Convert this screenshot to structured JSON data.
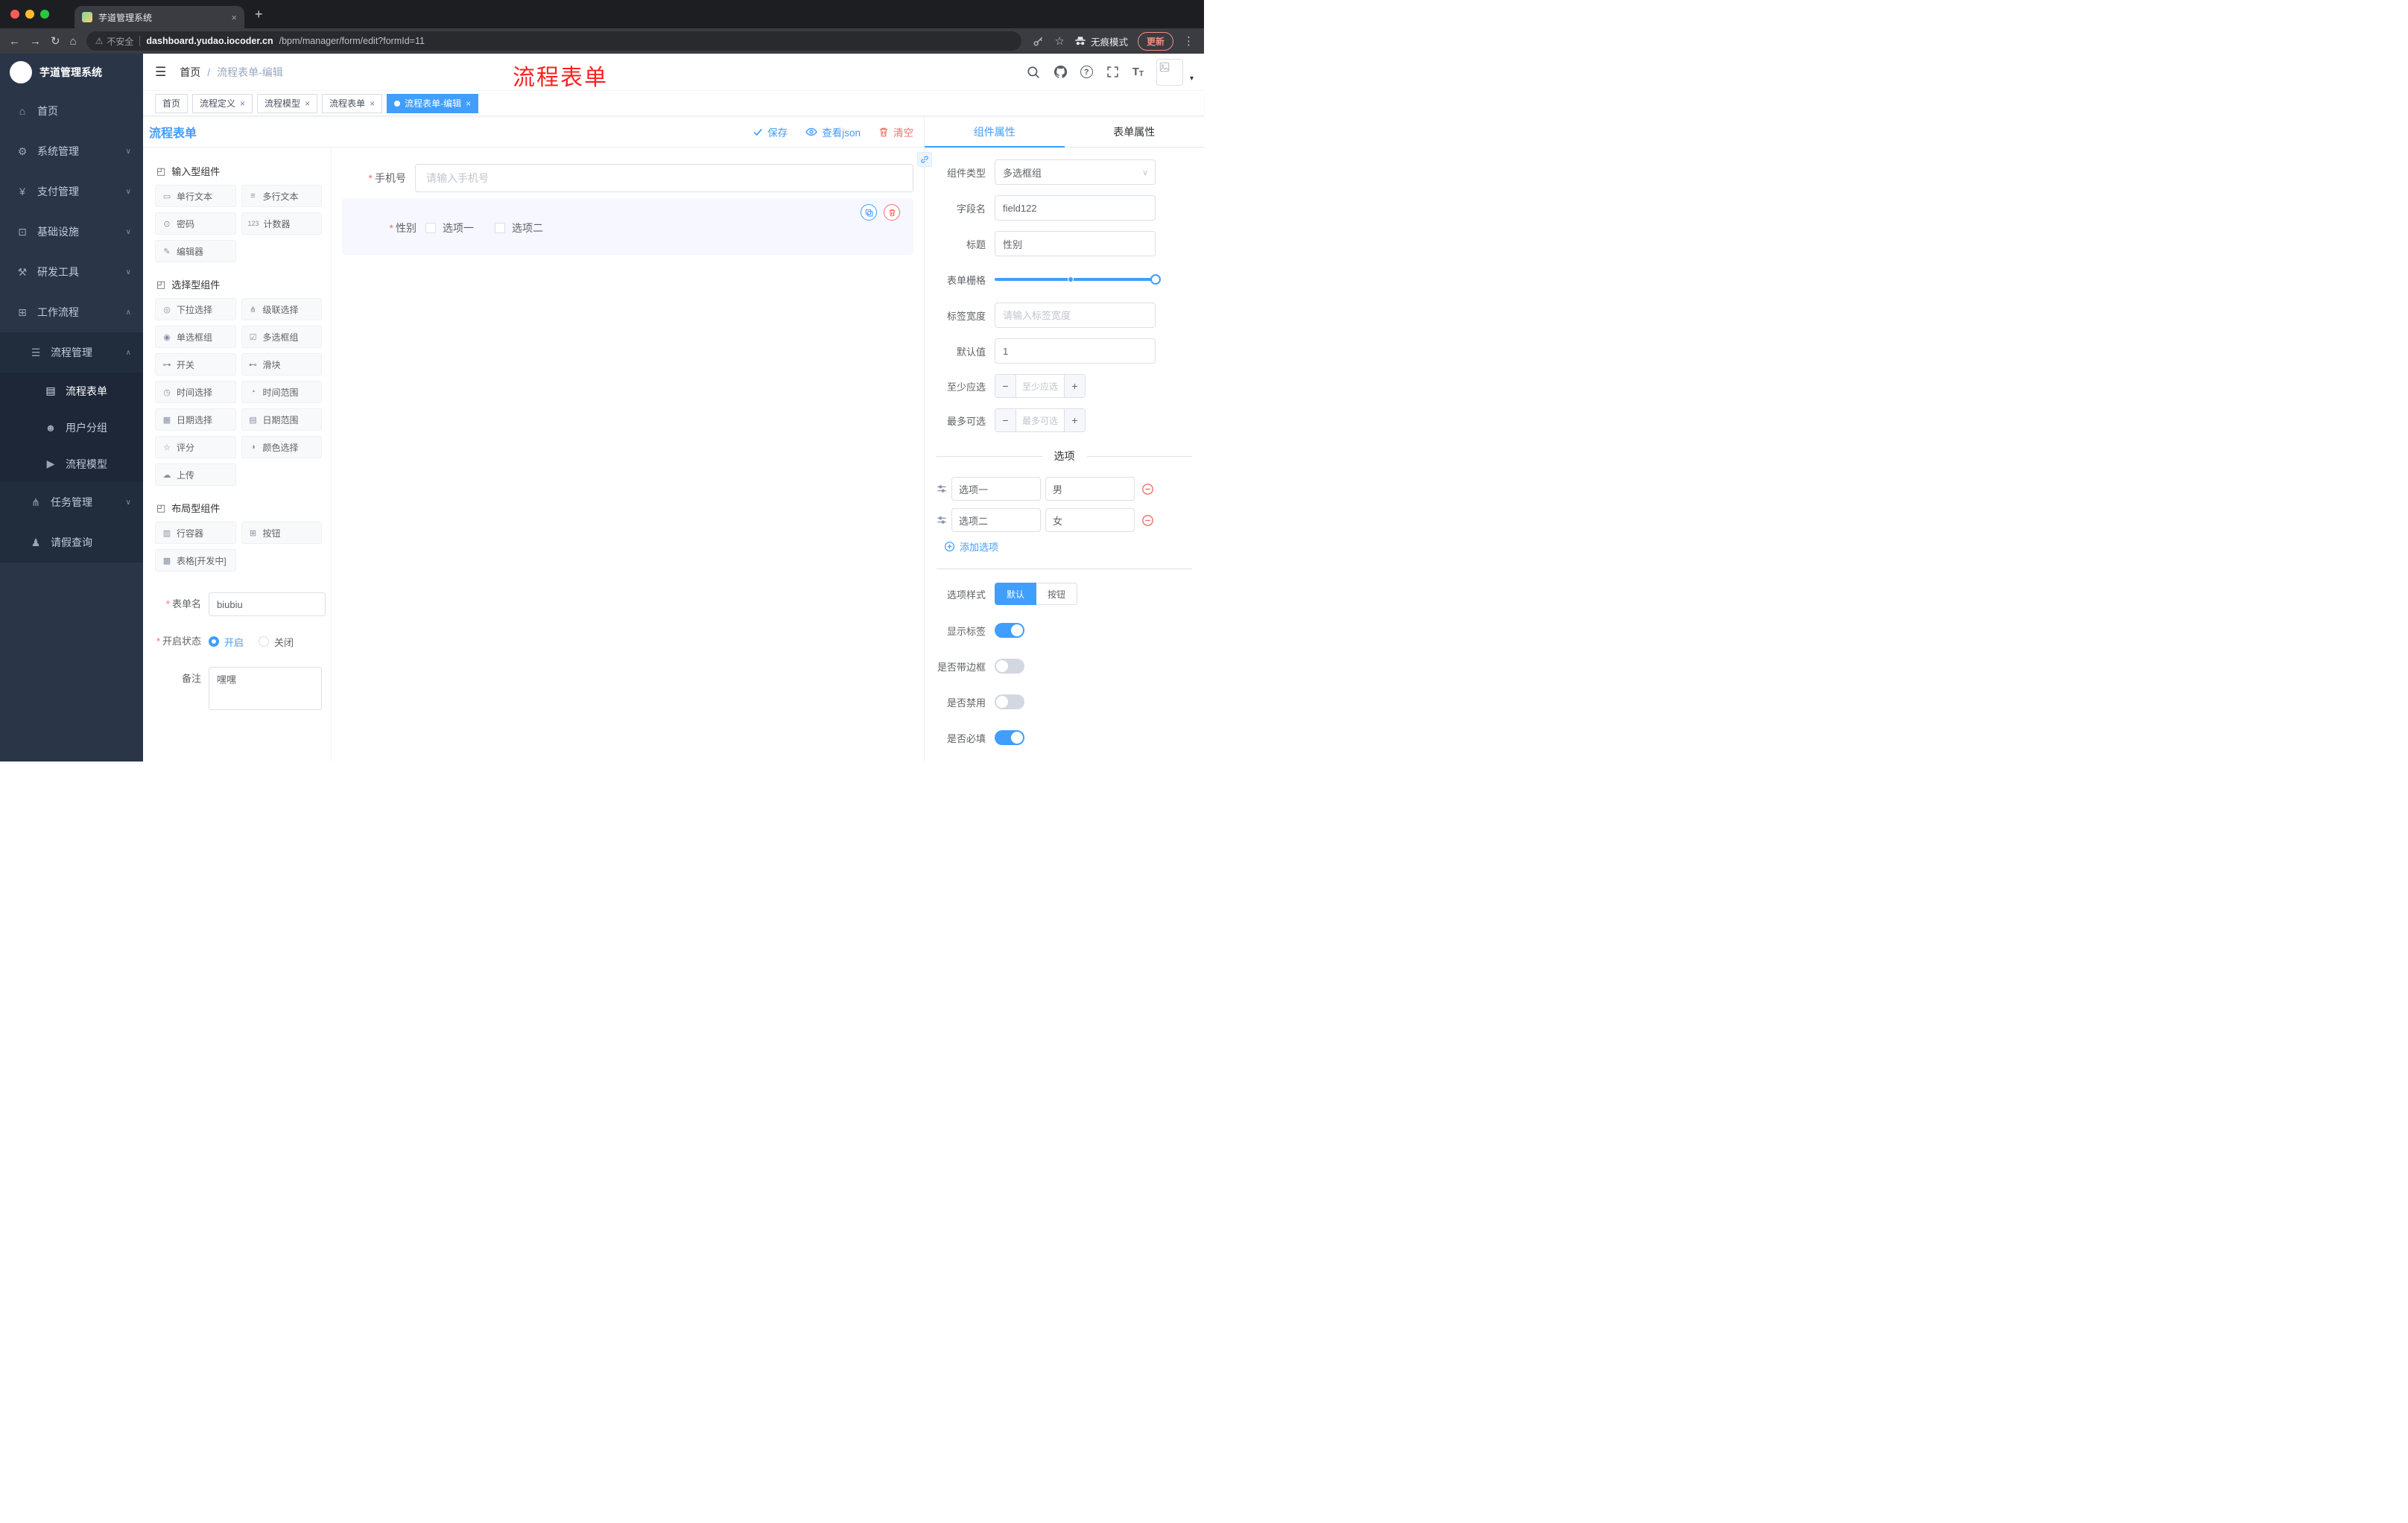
{
  "ui": {
    "asterisk": "*",
    "close": "×",
    "plus": "+",
    "minus": "−",
    "caret_down": "∨",
    "kebab": "⋮",
    "caret_small": "▾"
  },
  "browser": {
    "tab_title": "芋道管理系统",
    "security": "不安全",
    "url_domain": "dashboard.yudao.iocoder.cn",
    "url_path": "/bpm/manager/form/edit?formId=11",
    "incognito": "无痕模式",
    "update": "更新",
    "icons": {
      "back": "←",
      "forward": "→",
      "reload": "↻",
      "home": "⌂",
      "warning": "⚠",
      "star": "☆"
    }
  },
  "sidebar": {
    "title": "芋道管理系统",
    "items": [
      {
        "icon": "⌂",
        "label": "首页",
        "chevron": ""
      },
      {
        "icon": "⚙",
        "label": "系统管理",
        "chevron": "∨"
      },
      {
        "icon": "¥",
        "label": "支付管理",
        "chevron": "∨"
      },
      {
        "icon": "⊡",
        "label": "基础设施",
        "chevron": "∨"
      },
      {
        "icon": "⚒",
        "label": "研发工具",
        "chevron": "∨"
      },
      {
        "icon": "⊞",
        "label": "工作流程",
        "chevron": "∧"
      }
    ],
    "process_mgmt": {
      "icon": "☰",
      "label": "流程管理",
      "chevron": "∧"
    },
    "children": [
      {
        "icon": "▤",
        "label": "流程表单"
      },
      {
        "icon": "☻",
        "label": "用户分组"
      },
      {
        "icon": "▶",
        "label": "流程模型"
      }
    ],
    "task_mgmt": {
      "icon": "⋔",
      "label": "任务管理",
      "chevron": "∨"
    },
    "leave": {
      "icon": "♟",
      "label": "请假查询"
    }
  },
  "navbar": {
    "hamburger": "☰",
    "breadcrumb_home": "首页",
    "breadcrumb_sep": "/",
    "breadcrumb_current": "流程表单-编辑",
    "annotation": "流程表单",
    "question": "?",
    "font_big": "T",
    "font_small": "T"
  },
  "tags": [
    {
      "label": "首页"
    },
    {
      "label": "流程定义"
    },
    {
      "label": "流程模型"
    },
    {
      "label": "流程表单"
    },
    {
      "label": "流程表单-编辑"
    }
  ],
  "designer": {
    "title": "流程表单",
    "save": "保存",
    "view_json": "查看json",
    "clear": "清空",
    "groups": [
      {
        "icon": "◰",
        "title": "输入型组件",
        "items": [
          {
            "icon": "▭",
            "label": "单行文本"
          },
          {
            "icon": "≡",
            "label": "多行文本"
          },
          {
            "icon": "⊙",
            "label": "密码"
          },
          {
            "icon": "123",
            "label": "计数器"
          },
          {
            "icon": "✎",
            "label": "编辑器"
          }
        ]
      },
      {
        "icon": "◰",
        "title": "选择型组件",
        "items": [
          {
            "icon": "◎",
            "label": "下拉选择"
          },
          {
            "icon": "⋔",
            "label": "级联选择"
          },
          {
            "icon": "◉",
            "label": "单选框组"
          },
          {
            "icon": "☑",
            "label": "多选框组"
          },
          {
            "icon": "⊶",
            "label": "开关"
          },
          {
            "icon": "⊷",
            "label": "滑块"
          },
          {
            "icon": "◷",
            "label": "时间选择"
          },
          {
            "icon": "◔",
            "label": "时间范围"
          },
          {
            "icon": "▦",
            "label": "日期选择"
          },
          {
            "icon": "▤",
            "label": "日期范围"
          },
          {
            "icon": "☆",
            "label": "评分"
          },
          {
            "icon": "◑",
            "label": "颜色选择"
          },
          {
            "icon": "☁",
            "label": "上传"
          }
        ]
      },
      {
        "icon": "◰",
        "title": "布局型组件",
        "items": [
          {
            "icon": "▥",
            "label": "行容器"
          },
          {
            "icon": "⊞",
            "label": "按钮"
          },
          {
            "icon": "▩",
            "label": "表格[开发中]"
          }
        ]
      }
    ],
    "meta": {
      "name_label": "表单名",
      "name_value": "biubiu",
      "status_label": "开启状态",
      "status_on": "开启",
      "status_off": "关闭",
      "remark_label": "备注",
      "remark_value": "嘿嘿"
    },
    "canvas": {
      "phone_label": "手机号",
      "phone_placeholder": "请输入手机号",
      "gender_label": "性别",
      "option1": "选项一",
      "option2": "选项二"
    }
  },
  "props": {
    "tab_component": "组件属性",
    "tab_form": "表单属性",
    "type_label": "组件类型",
    "type_value": "多选框组",
    "field_label": "字段名",
    "field_value": "field122",
    "title_label": "标题",
    "title_value": "性别",
    "grid_label": "表单栅格",
    "width_label": "标签宽度",
    "width_placeholder": "请输入标签宽度",
    "default_label": "默认值",
    "default_value": "1",
    "min_label": "至少应选",
    "min_placeholder": "至少应选",
    "max_label": "最多可选",
    "max_placeholder": "最多可选",
    "options_title": "选项",
    "options": [
      {
        "label": "选项一",
        "value": "男"
      },
      {
        "label": "选项二",
        "value": "女"
      }
    ],
    "add_option": "添加选项",
    "style_label": "选项样式",
    "style_default": "默认",
    "style_button": "按钮",
    "show_label": "显示标签",
    "border_label": "是否带边框",
    "disabled_label": "是否禁用",
    "required_label": "是否必填"
  }
}
